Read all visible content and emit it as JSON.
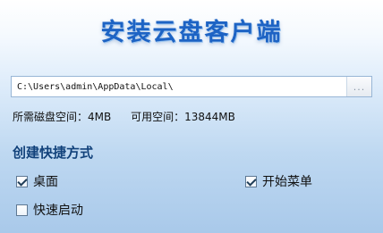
{
  "installer": {
    "title": "安装云盘客户端",
    "install_path": {
      "value": "C:\\Users\\admin\\AppData\\Local\\",
      "browse_label": "..."
    },
    "disk_space": {
      "required_label": "所需磁盘空间：4MB",
      "available_label": "可用空间：13844MB"
    },
    "shortcuts": {
      "heading": "创建快捷方式",
      "desktop": {
        "label": "桌面",
        "checked": true
      },
      "start_menu": {
        "label": "开始菜单",
        "checked": true
      },
      "quick_launch": {
        "label": "快速启动",
        "checked": false
      }
    }
  }
}
